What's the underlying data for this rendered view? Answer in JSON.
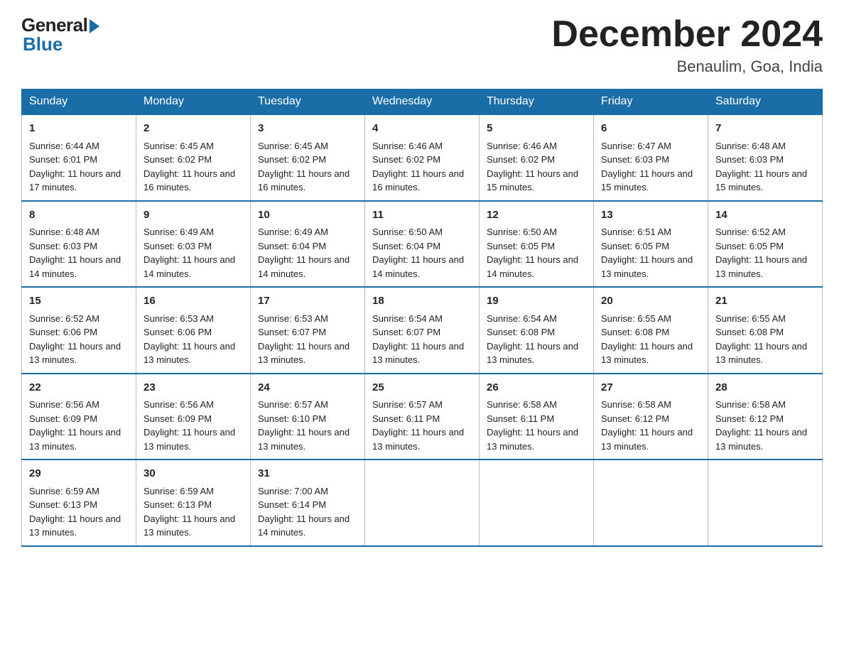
{
  "logo": {
    "general": "General",
    "blue": "Blue"
  },
  "title": "December 2024",
  "location": "Benaulim, Goa, India",
  "days_of_week": [
    "Sunday",
    "Monday",
    "Tuesday",
    "Wednesday",
    "Thursday",
    "Friday",
    "Saturday"
  ],
  "weeks": [
    [
      {
        "num": "1",
        "sunrise": "6:44 AM",
        "sunset": "6:01 PM",
        "daylight": "11 hours and 17 minutes."
      },
      {
        "num": "2",
        "sunrise": "6:45 AM",
        "sunset": "6:02 PM",
        "daylight": "11 hours and 16 minutes."
      },
      {
        "num": "3",
        "sunrise": "6:45 AM",
        "sunset": "6:02 PM",
        "daylight": "11 hours and 16 minutes."
      },
      {
        "num": "4",
        "sunrise": "6:46 AM",
        "sunset": "6:02 PM",
        "daylight": "11 hours and 16 minutes."
      },
      {
        "num": "5",
        "sunrise": "6:46 AM",
        "sunset": "6:02 PM",
        "daylight": "11 hours and 15 minutes."
      },
      {
        "num": "6",
        "sunrise": "6:47 AM",
        "sunset": "6:03 PM",
        "daylight": "11 hours and 15 minutes."
      },
      {
        "num": "7",
        "sunrise": "6:48 AM",
        "sunset": "6:03 PM",
        "daylight": "11 hours and 15 minutes."
      }
    ],
    [
      {
        "num": "8",
        "sunrise": "6:48 AM",
        "sunset": "6:03 PM",
        "daylight": "11 hours and 14 minutes."
      },
      {
        "num": "9",
        "sunrise": "6:49 AM",
        "sunset": "6:03 PM",
        "daylight": "11 hours and 14 minutes."
      },
      {
        "num": "10",
        "sunrise": "6:49 AM",
        "sunset": "6:04 PM",
        "daylight": "11 hours and 14 minutes."
      },
      {
        "num": "11",
        "sunrise": "6:50 AM",
        "sunset": "6:04 PM",
        "daylight": "11 hours and 14 minutes."
      },
      {
        "num": "12",
        "sunrise": "6:50 AM",
        "sunset": "6:05 PM",
        "daylight": "11 hours and 14 minutes."
      },
      {
        "num": "13",
        "sunrise": "6:51 AM",
        "sunset": "6:05 PM",
        "daylight": "11 hours and 13 minutes."
      },
      {
        "num": "14",
        "sunrise": "6:52 AM",
        "sunset": "6:05 PM",
        "daylight": "11 hours and 13 minutes."
      }
    ],
    [
      {
        "num": "15",
        "sunrise": "6:52 AM",
        "sunset": "6:06 PM",
        "daylight": "11 hours and 13 minutes."
      },
      {
        "num": "16",
        "sunrise": "6:53 AM",
        "sunset": "6:06 PM",
        "daylight": "11 hours and 13 minutes."
      },
      {
        "num": "17",
        "sunrise": "6:53 AM",
        "sunset": "6:07 PM",
        "daylight": "11 hours and 13 minutes."
      },
      {
        "num": "18",
        "sunrise": "6:54 AM",
        "sunset": "6:07 PM",
        "daylight": "11 hours and 13 minutes."
      },
      {
        "num": "19",
        "sunrise": "6:54 AM",
        "sunset": "6:08 PM",
        "daylight": "11 hours and 13 minutes."
      },
      {
        "num": "20",
        "sunrise": "6:55 AM",
        "sunset": "6:08 PM",
        "daylight": "11 hours and 13 minutes."
      },
      {
        "num": "21",
        "sunrise": "6:55 AM",
        "sunset": "6:08 PM",
        "daylight": "11 hours and 13 minutes."
      }
    ],
    [
      {
        "num": "22",
        "sunrise": "6:56 AM",
        "sunset": "6:09 PM",
        "daylight": "11 hours and 13 minutes."
      },
      {
        "num": "23",
        "sunrise": "6:56 AM",
        "sunset": "6:09 PM",
        "daylight": "11 hours and 13 minutes."
      },
      {
        "num": "24",
        "sunrise": "6:57 AM",
        "sunset": "6:10 PM",
        "daylight": "11 hours and 13 minutes."
      },
      {
        "num": "25",
        "sunrise": "6:57 AM",
        "sunset": "6:11 PM",
        "daylight": "11 hours and 13 minutes."
      },
      {
        "num": "26",
        "sunrise": "6:58 AM",
        "sunset": "6:11 PM",
        "daylight": "11 hours and 13 minutes."
      },
      {
        "num": "27",
        "sunrise": "6:58 AM",
        "sunset": "6:12 PM",
        "daylight": "11 hours and 13 minutes."
      },
      {
        "num": "28",
        "sunrise": "6:58 AM",
        "sunset": "6:12 PM",
        "daylight": "11 hours and 13 minutes."
      }
    ],
    [
      {
        "num": "29",
        "sunrise": "6:59 AM",
        "sunset": "6:13 PM",
        "daylight": "11 hours and 13 minutes."
      },
      {
        "num": "30",
        "sunrise": "6:59 AM",
        "sunset": "6:13 PM",
        "daylight": "11 hours and 13 minutes."
      },
      {
        "num": "31",
        "sunrise": "7:00 AM",
        "sunset": "6:14 PM",
        "daylight": "11 hours and 14 minutes."
      },
      null,
      null,
      null,
      null
    ]
  ],
  "labels": {
    "sunrise": "Sunrise:",
    "sunset": "Sunset:",
    "daylight": "Daylight:"
  }
}
